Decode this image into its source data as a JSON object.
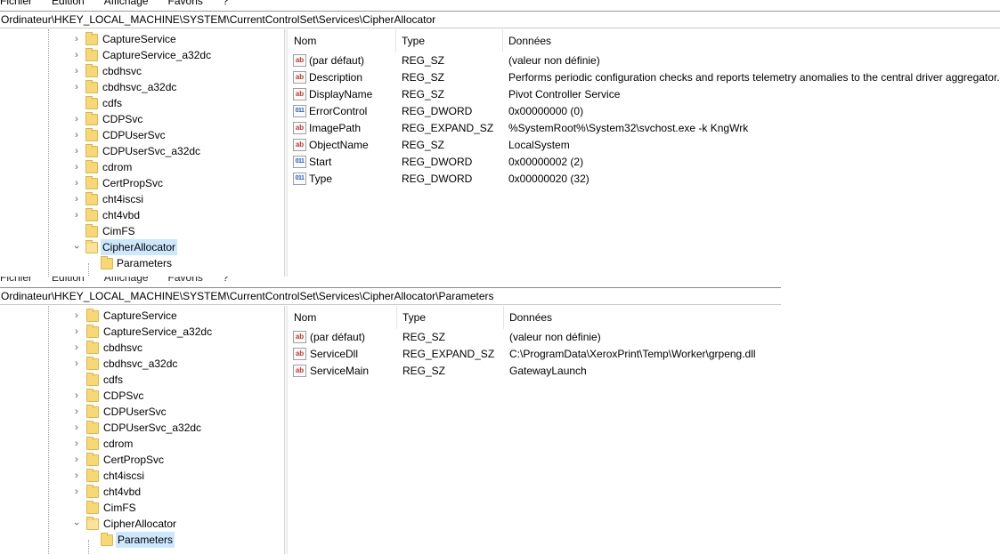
{
  "window1": {
    "menu": [
      "Fichier",
      "Edition",
      "Affichage",
      "Favoris",
      "?"
    ],
    "address": "Ordinateur\\HKEY_LOCAL_MACHINE\\SYSTEM\\CurrentControlSet\\Services\\CipherAllocator",
    "tree": [
      "CaptureService",
      "CaptureService_a32dc",
      "cbdhsvc",
      "cbdhsvc_a32dc",
      "cdfs",
      "CDPSvc",
      "CDPUserSvc",
      "CDPUserSvc_a32dc",
      "cdrom",
      "CertPropSvc",
      "cht4iscsi",
      "cht4vbd",
      "CimFS",
      "CipherAllocator",
      "Parameters"
    ],
    "columns": [
      "Nom",
      "Type",
      "Données"
    ],
    "values": [
      {
        "icon": "string-value-icon",
        "name": "(par défaut)",
        "type": "REG_SZ",
        "data": "(valeur non définie)"
      },
      {
        "icon": "string-value-icon",
        "name": "Description",
        "type": "REG_SZ",
        "data": "Performs periodic configuration checks and reports telemetry anomalies to the central driver aggregator."
      },
      {
        "icon": "string-value-icon",
        "name": "DisplayName",
        "type": "REG_SZ",
        "data": "Pivot Controller Service"
      },
      {
        "icon": "dword-value-icon",
        "name": "ErrorControl",
        "type": "REG_DWORD",
        "data": "0x00000000 (0)"
      },
      {
        "icon": "string-value-icon",
        "name": "ImagePath",
        "type": "REG_EXPAND_SZ",
        "data": "%SystemRoot%\\System32\\svchost.exe -k KngWrk"
      },
      {
        "icon": "string-value-icon",
        "name": "ObjectName",
        "type": "REG_SZ",
        "data": "LocalSystem"
      },
      {
        "icon": "dword-value-icon",
        "name": "Start",
        "type": "REG_DWORD",
        "data": "0x00000002 (2)"
      },
      {
        "icon": "dword-value-icon",
        "name": "Type",
        "type": "REG_DWORD",
        "data": "0x00000020 (32)"
      }
    ]
  },
  "window2": {
    "menu": [
      "Fichier",
      "Edition",
      "Affichage",
      "Favoris",
      "?"
    ],
    "address": "Ordinateur\\HKEY_LOCAL_MACHINE\\SYSTEM\\CurrentControlSet\\Services\\CipherAllocator\\Parameters",
    "tree": [
      "CaptureService",
      "CaptureService_a32dc",
      "cbdhsvc",
      "cbdhsvc_a32dc",
      "cdfs",
      "CDPSvc",
      "CDPUserSvc",
      "CDPUserSvc_a32dc",
      "cdrom",
      "CertPropSvc",
      "cht4iscsi",
      "cht4vbd",
      "CimFS",
      "CipherAllocator",
      "Parameters"
    ],
    "columns": [
      "Nom",
      "Type",
      "Données"
    ],
    "values": [
      {
        "icon": "string-value-icon",
        "name": "(par défaut)",
        "type": "REG_SZ",
        "data": "(valeur non définie)"
      },
      {
        "icon": "string-value-icon",
        "name": "ServiceDll",
        "type": "REG_EXPAND_SZ",
        "data": "C:\\ProgramData\\XeroxPrint\\Temp\\Worker\\grpeng.dll"
      },
      {
        "icon": "string-value-icon",
        "name": "ServiceMain",
        "type": "REG_SZ",
        "data": "GatewayLaunch"
      }
    ]
  }
}
